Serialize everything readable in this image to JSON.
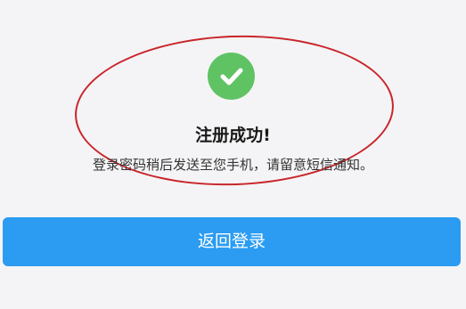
{
  "success": {
    "icon": "check-icon",
    "icon_color": "#5fc364",
    "title": "注册成功!",
    "message": "登录密码稍后发送至您手机，请留意短信通知。"
  },
  "actions": {
    "back_label": "返回登录",
    "button_color": "#2b9cf2"
  },
  "annotation": {
    "color": "#c9252b"
  }
}
